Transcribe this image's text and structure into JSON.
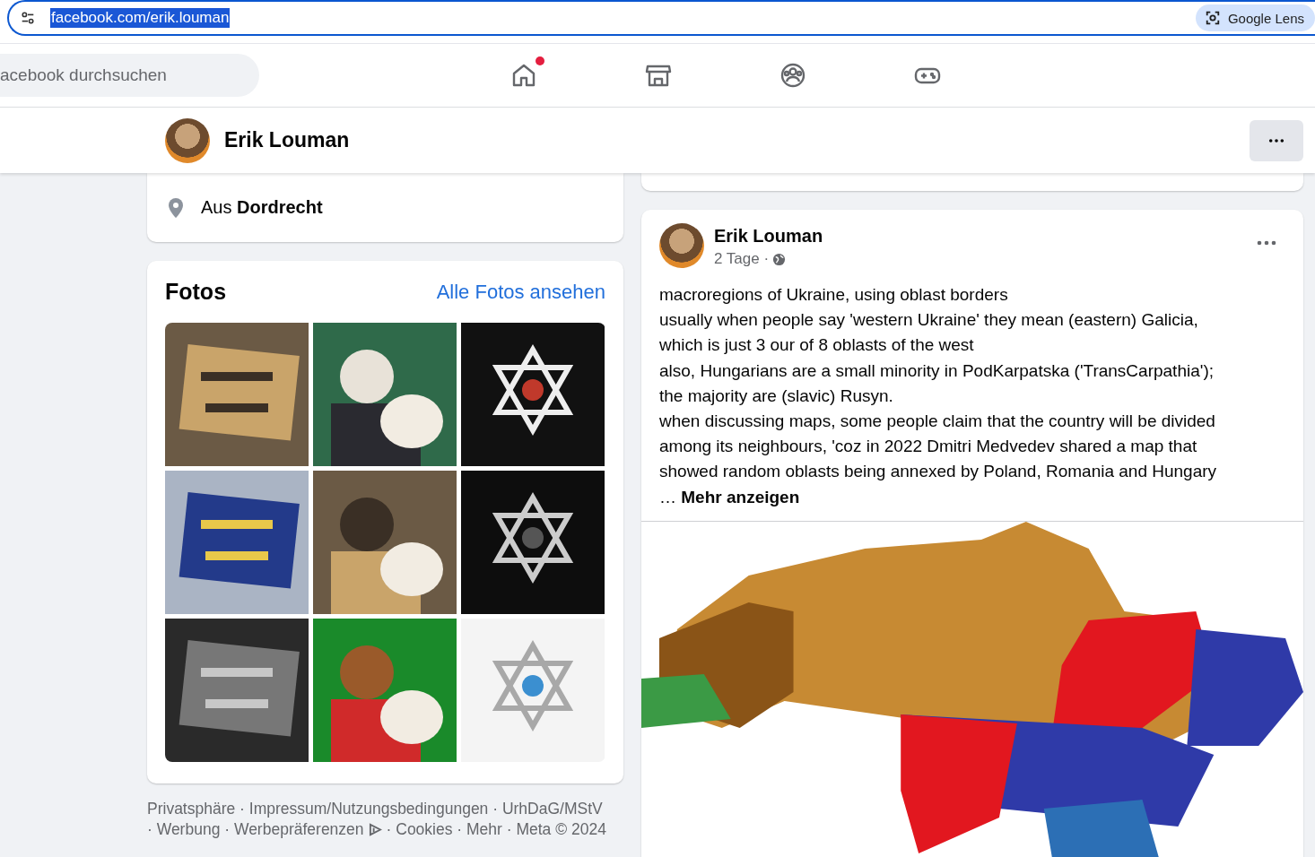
{
  "address_bar": {
    "url": "facebook.com/erik.louman",
    "lens_button": "Google Lens"
  },
  "nav": {
    "search_placeholder": "acebook durchsuchen",
    "items": [
      {
        "notification": true
      },
      {
        "notification": false
      },
      {
        "notification": false
      },
      {
        "notification": false
      }
    ]
  },
  "profile_header": {
    "name": "Erik Louman"
  },
  "intro": {
    "prefix": "Aus",
    "city": "Dordrecht"
  },
  "photos": {
    "title": "Fotos",
    "see_all": "Alle Fotos ansehen",
    "items": [
      {
        "kind": "picture"
      },
      {
        "kind": "picture"
      },
      {
        "kind": "picture"
      },
      {
        "kind": "picture"
      },
      {
        "kind": "picture"
      },
      {
        "kind": "picture"
      },
      {
        "kind": "picture"
      },
      {
        "kind": "picture"
      },
      {
        "kind": "picture"
      }
    ]
  },
  "footer": {
    "line_1": "Privatsphäre · Impressum/Nutzungsbedingungen · UrhDaG/MStV",
    "line_2_before_icon": "· Werbung · Werbepräferenzen",
    "line_2_after_icon": "· Cookies · Mehr · Meta © 2024"
  },
  "post": {
    "author": "Erik Louman",
    "time": "2 Tage ·",
    "lines": [
      "macroregions of Ukraine, using oblast borders",
      "usually when people say 'western Ukraine' they mean (eastern) Galicia,",
      "which is just 3 our of 8 oblasts of the west",
      "also, Hungarians are a small minority in PodKarpatska ('TransCarpathia');",
      "the majority are (slavic) Rusyn.",
      "when discussing maps, some people claim that the country will be divided",
      "among its neighbours, 'coz in 2022 Dmitri Medvedev shared a map that",
      "showed random oblasts being annexed by Poland, Romania and Hungary"
    ],
    "ellipsis": "…",
    "more": "Mehr anzeigen",
    "image": {
      "kind": "picture"
    }
  }
}
